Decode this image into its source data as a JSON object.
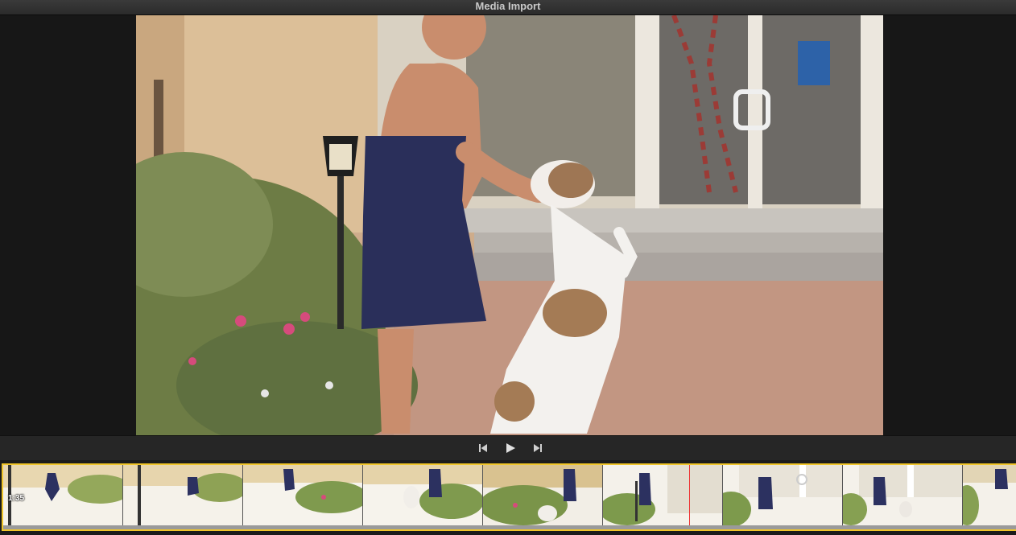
{
  "window": {
    "title": "Media Import"
  },
  "viewer": {
    "frame_icons": [
      "woman-figure",
      "dog-figure",
      "lamp-post",
      "glass-door",
      "flower-bush",
      "brick-courtyard"
    ]
  },
  "transport": {
    "buttons": [
      "skip-back-icon",
      "play-icon",
      "skip-forward-icon"
    ],
    "icon_color": "#cfcfcf"
  },
  "filmstrip": {
    "timecode": "1:35",
    "selection_color": "#f0c52a",
    "playhead_color": "#e33333",
    "thumbnail_count": 9
  }
}
